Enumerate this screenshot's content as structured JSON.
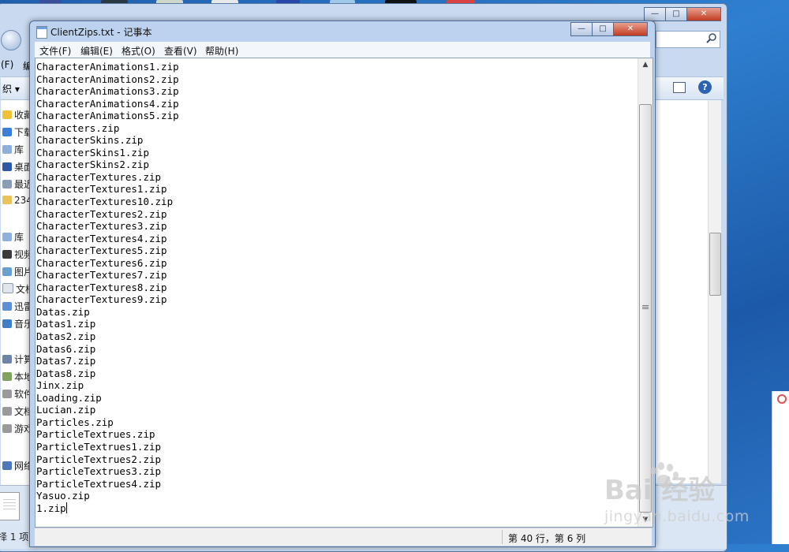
{
  "explorer": {
    "menu_first": "(F)",
    "menu_second": "编",
    "toolbar_organize": "织 ▾",
    "help_glyph": "?",
    "sidebar": [
      {
        "label": "收藏夹",
        "icon": "star-icon"
      },
      {
        "label": "下载",
        "icon": "download-folder-icon"
      },
      {
        "label": "库",
        "icon": "library-icon"
      },
      {
        "label": "桌面",
        "icon": "desktop-icon"
      },
      {
        "label": "最近",
        "icon": "recent-places-icon"
      },
      {
        "label": "234",
        "icon": "folder-icon"
      },
      {
        "label": "库",
        "icon": "library-icon"
      },
      {
        "label": "视频",
        "icon": "video-icon"
      },
      {
        "label": "图片",
        "icon": "picture-icon"
      },
      {
        "label": "文档",
        "icon": "document-icon"
      },
      {
        "label": "迅雷",
        "icon": "thunder-icon"
      },
      {
        "label": "音乐",
        "icon": "music-icon"
      },
      {
        "label": "计算机",
        "icon": "computer-icon"
      },
      {
        "label": "本地",
        "icon": "local-disk-icon"
      },
      {
        "label": "软件",
        "icon": "drive-icon"
      },
      {
        "label": "文档",
        "icon": "drive-icon"
      },
      {
        "label": "游戏",
        "icon": "drive-icon"
      },
      {
        "label": "网络",
        "icon": "network-icon"
      }
    ],
    "status_text": "择 1 项"
  },
  "notepad": {
    "title": "ClientZips.txt - 记事本",
    "menu": [
      "文件(F)",
      "编辑(E)",
      "格式(O)",
      "查看(V)",
      "帮助(H)"
    ],
    "lines": [
      "CharacterAnimations1.zip",
      "CharacterAnimations2.zip",
      "CharacterAnimations3.zip",
      "CharacterAnimations4.zip",
      "CharacterAnimations5.zip",
      "Characters.zip",
      "CharacterSkins.zip",
      "CharacterSkins1.zip",
      "CharacterSkins2.zip",
      "CharacterTextures.zip",
      "CharacterTextures1.zip",
      "CharacterTextures10.zip",
      "CharacterTextures2.zip",
      "CharacterTextures3.zip",
      "CharacterTextures4.zip",
      "CharacterTextures5.zip",
      "CharacterTextures6.zip",
      "CharacterTextures7.zip",
      "CharacterTextures8.zip",
      "CharacterTextures9.zip",
      "Datas.zip",
      "Datas1.zip",
      "Datas2.zip",
      "Datas6.zip",
      "Datas7.zip",
      "Datas8.zip",
      "Jinx.zip",
      "Loading.zip",
      "Lucian.zip",
      "Particles.zip",
      "ParticleTextrues.zip",
      "ParticleTextrues1.zip",
      "ParticleTextrues2.zip",
      "ParticleTextrues3.zip",
      "ParticleTextrues4.zip",
      "Yasuo.zip",
      "1.zip"
    ],
    "status": "第 40 行，第 6 列"
  },
  "window_controls": {
    "minimize": "—",
    "maximize": "□",
    "close": "✕"
  },
  "watermark": {
    "main": "Bai  经验",
    "sub": "jingyan.baidu.com"
  },
  "colors": {
    "desktop": "#2c73c5",
    "titlebar": "#bcd2ee",
    "close_button": "#c23b22"
  }
}
